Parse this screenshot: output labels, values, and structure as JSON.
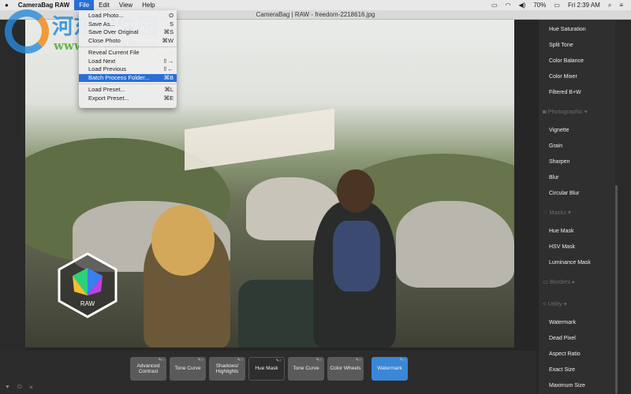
{
  "menubar": {
    "apple": "",
    "app": "CameraBag RAW",
    "items": [
      "File",
      "Edit",
      "View",
      "Help"
    ],
    "battery": "70%",
    "clock": "Fri 2:39 AM"
  },
  "window": {
    "title": "CameraBag | RAW - freedom-2218616.jpg"
  },
  "file_menu": {
    "items": [
      {
        "label": "Load Photo...",
        "shortcut": "O"
      },
      {
        "label": "Save As...",
        "shortcut": "S"
      },
      {
        "label": "Save Over Original",
        "shortcut": "⌘S"
      },
      {
        "label": "Close Photo",
        "shortcut": "⌘W"
      },
      {
        "label": "Reveal Current File",
        "shortcut": ""
      },
      {
        "label": "Load Next",
        "shortcut": "⇧→"
      },
      {
        "label": "Load Previous",
        "shortcut": "⇧←"
      },
      {
        "label": "Batch Process Folder...",
        "shortcut": "⌘B"
      },
      {
        "label": "Load Preset...",
        "shortcut": "⌘L"
      },
      {
        "label": "Export Preset...",
        "shortcut": "⌘E"
      }
    ]
  },
  "logo": {
    "text": "RAW"
  },
  "watermark": {
    "cn": "河东软件园",
    "url": "www.pc0359.cn"
  },
  "panel": {
    "color_items": [
      "Hue Saturation",
      "Split Tone",
      "Color Balance",
      "Color Mixer",
      "Filtered B+W"
    ],
    "photographic": {
      "label": "Photographic",
      "items": [
        "Vignette",
        "Grain",
        "Sharpen",
        "Blur",
        "Circular Blur"
      ]
    },
    "masks": {
      "label": "Masks",
      "items": [
        "Hue Mask",
        "HSV Mask",
        "Luminance Mask"
      ]
    },
    "borders": {
      "label": "Borders"
    },
    "utility": {
      "label": "Utility",
      "items": [
        "Watermark",
        "Dead Pixel",
        "Aspect Ratio",
        "Exact Size",
        "Maximum Size"
      ]
    }
  },
  "adjustments": [
    "Advanced Contrast",
    "Tone Curve",
    "Shadows/ Highlights",
    "Hue Mask",
    "Tone Curve",
    "Color Wheels",
    "Watermark"
  ],
  "accent": "#3a87d6"
}
